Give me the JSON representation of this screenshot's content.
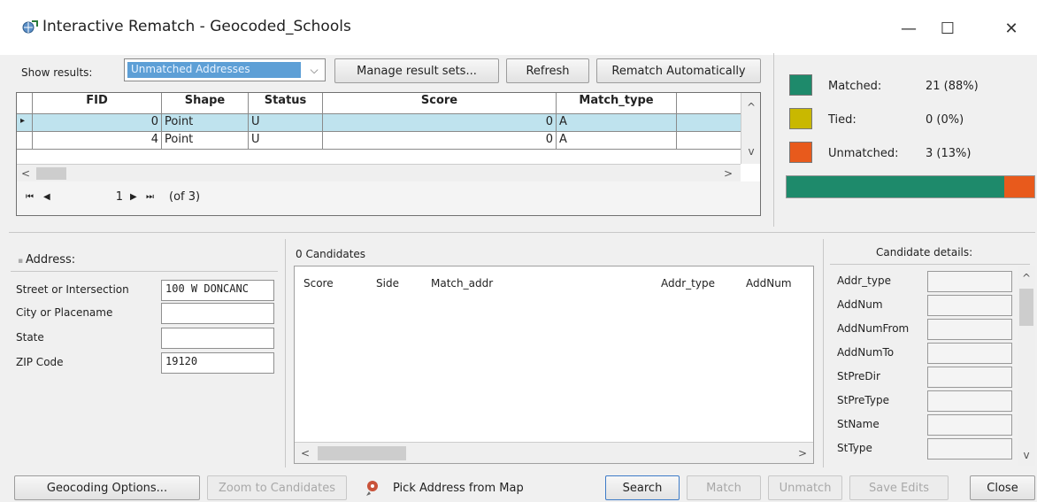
{
  "window": {
    "title": "Interactive Rematch - Geocoded_Schools",
    "minimize_glyph": "—",
    "maximize_glyph": "☐",
    "close_glyph": "✕"
  },
  "toolbar": {
    "show_results_label": "Show results:",
    "show_results_value": "Unmatched Addresses",
    "manage_label": "Manage result sets...",
    "refresh_label": "Refresh",
    "rematch_auto_label": "Rematch Automatically"
  },
  "results_table": {
    "columns": [
      "FID",
      "Shape",
      "Status",
      "Score",
      "Match_type"
    ],
    "rows": [
      {
        "fid": "0",
        "shape": "Point",
        "status": "U",
        "score": "0",
        "match_type": "A",
        "selected": true
      },
      {
        "fid": "4",
        "shape": "Point",
        "status": "U",
        "score": "0",
        "match_type": "A",
        "selected": false
      }
    ],
    "row_indicator": "▸"
  },
  "pager": {
    "current": "1",
    "of_text": "(of 3)"
  },
  "stats": {
    "matched_label": "Matched:",
    "matched_value": "21 (88%)",
    "tied_label": "Tied:",
    "tied_value": "0 (0%)",
    "unmatched_label": "Unmatched:",
    "unmatched_value": "3 (13%)",
    "colors": {
      "matched": "#1e8a6b",
      "tied": "#c9b800",
      "unmatched": "#e85a1c"
    },
    "matched_fraction": 0.88
  },
  "address": {
    "header": "Address:",
    "fields": [
      {
        "label": "Street or Intersection",
        "value": "100 W DONCANC"
      },
      {
        "label": "City or Placename",
        "value": ""
      },
      {
        "label": "State",
        "value": ""
      },
      {
        "label": "ZIP Code",
        "value": "19120"
      }
    ]
  },
  "candidates": {
    "header": "0 Candidates",
    "columns": [
      "Score",
      "Side",
      "Match_addr",
      "Addr_type",
      "AddNum"
    ]
  },
  "candidate_details": {
    "header": "Candidate details:",
    "fields": [
      "Addr_type",
      "AddNum",
      "AddNumFrom",
      "AddNumTo",
      "StPreDir",
      "StPreType",
      "StName",
      "StType"
    ]
  },
  "bottom": {
    "geocoding_options": "Geocoding Options...",
    "zoom_candidates": "Zoom to Candidates",
    "pick_address": "Pick Address from Map",
    "search": "Search",
    "match": "Match",
    "unmatch": "Unmatch",
    "save_edits": "Save Edits",
    "close": "Close"
  }
}
